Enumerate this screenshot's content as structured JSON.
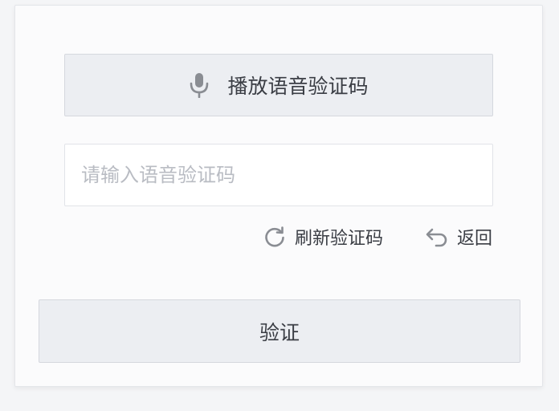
{
  "audio_button": {
    "label": "播放语音验证码",
    "icon": "microphone-icon"
  },
  "code_input": {
    "value": "",
    "placeholder": "请输入语音验证码"
  },
  "links": {
    "refresh": {
      "label": "刷新验证码",
      "icon": "refresh-icon"
    },
    "back": {
      "label": "返回",
      "icon": "undo-arrow-icon"
    }
  },
  "verify_button": {
    "label": "验证"
  },
  "colors": {
    "button_bg": "#eceef2",
    "border": "#d5d8de",
    "text": "#3a3d44",
    "icon": "#8a8d93",
    "placeholder": "#b9bcc3"
  }
}
